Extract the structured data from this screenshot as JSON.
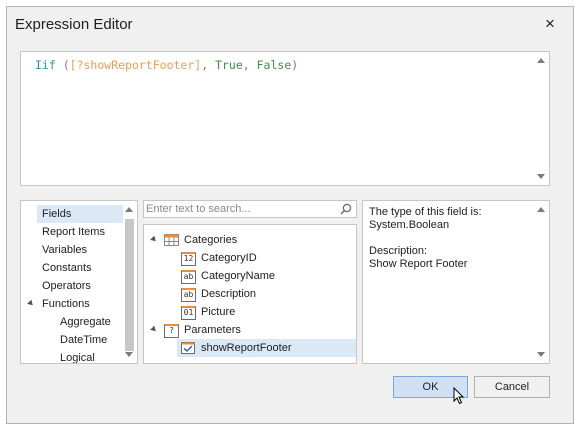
{
  "dialog": {
    "title": "Expression Editor",
    "close_label": "×"
  },
  "editor": {
    "tokens": {
      "func": "Iif",
      "open": " (",
      "param": "[?showReportFooter]",
      "comma1": ", ",
      "true_val": "True",
      "comma2": ", ",
      "false_val": "False",
      "close": ")"
    }
  },
  "categories": {
    "items": [
      {
        "label": "Fields",
        "selected": true
      },
      {
        "label": "Report Items"
      },
      {
        "label": "Variables"
      },
      {
        "label": "Constants"
      },
      {
        "label": "Operators"
      },
      {
        "label": "Functions",
        "expanded": true
      },
      {
        "label": "Aggregate"
      },
      {
        "label": "DateTime"
      },
      {
        "label": "Logical"
      }
    ]
  },
  "search": {
    "placeholder": "Enter text to search..."
  },
  "tree": {
    "categories": {
      "label": "Categories",
      "children": [
        {
          "label": "CategoryID",
          "type_badge": "12"
        },
        {
          "label": "CategoryName",
          "type_badge": "ab"
        },
        {
          "label": "Description",
          "type_badge": "ab"
        },
        {
          "label": "Picture",
          "type_badge": "01"
        }
      ]
    },
    "parameters": {
      "label": "Parameters",
      "badge": "?",
      "children": [
        {
          "label": "showReportFooter",
          "selected": true
        }
      ]
    }
  },
  "description": {
    "text": "The type of this field is:\nSystem.Boolean\n\nDescription:\nShow Report Footer"
  },
  "buttons": {
    "ok": "OK",
    "cancel": "Cancel"
  },
  "colors": {
    "keyword": "#2b91af",
    "parameter": "#f39c52",
    "boolean": "#3e8f3e",
    "selection": "#dbe8f6",
    "ok_button": "#cfe0f5"
  }
}
